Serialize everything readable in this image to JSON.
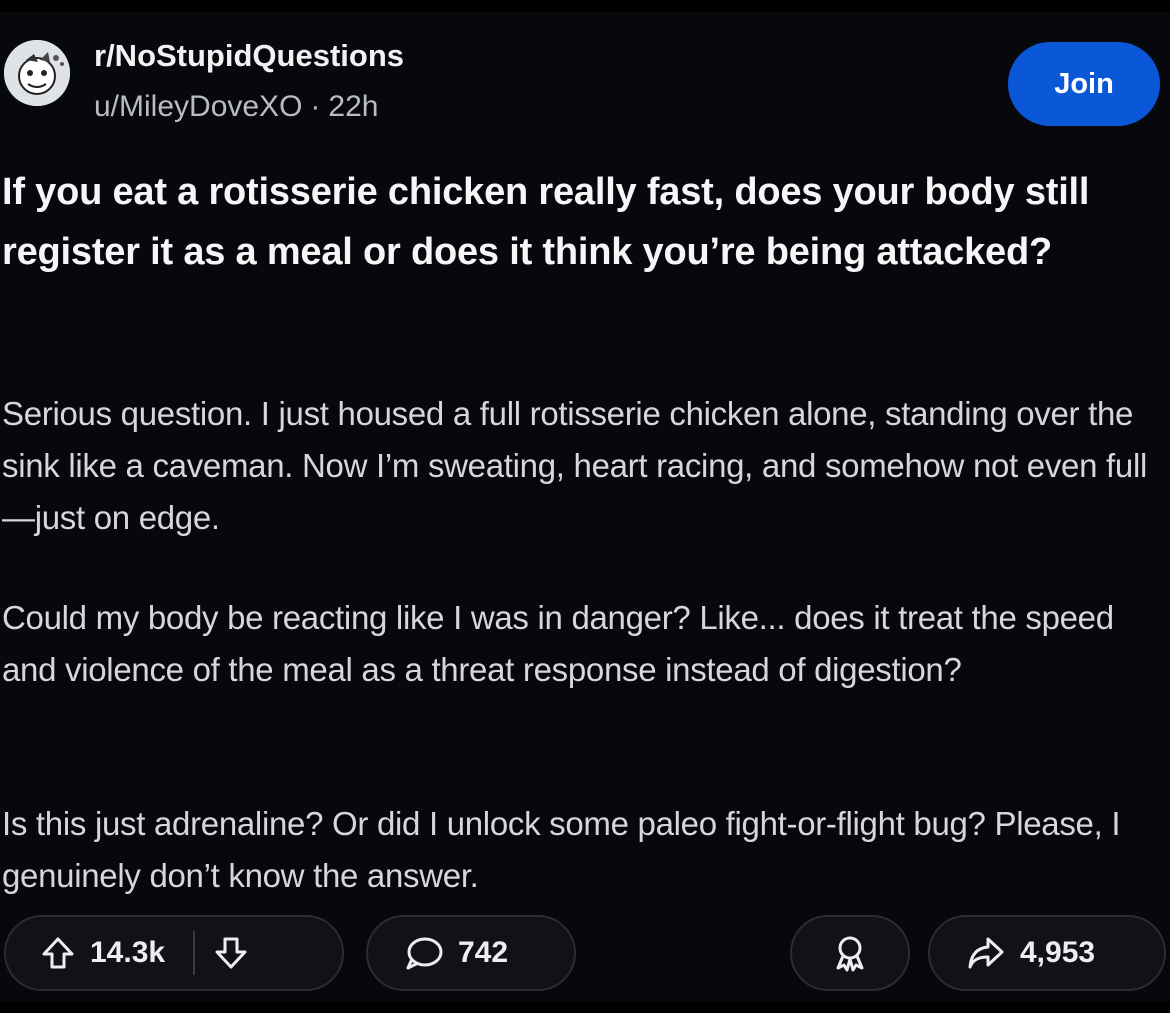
{
  "post": {
    "subreddit": "r/NoStupidQuestions",
    "author": "u/MileyDoveXO",
    "separator": "·",
    "age": "22h",
    "join_label": "Join",
    "title": "If you eat a rotisserie chicken really fast, does your body still register it as a meal or does it think you’re being attacked?",
    "body": [
      "Serious question. I just housed a full rotisserie chicken alone, standing over the sink like a caveman. Now I’m sweating, heart racing, and somehow not even full—just on edge.",
      "Could my body be reacting like I was in danger? Like... does it treat the speed and violence of the meal as a threat response instead of digestion?",
      "Is this just adrenaline? Or did I unlock some paleo fight-or-flight bug? Please, I genuinely don’t know the answer."
    ]
  },
  "actions": {
    "upvotes": "14.3k",
    "comments": "742",
    "shares": "4,953",
    "upvote_icon": "upvote-arrow-icon",
    "downvote_icon": "downvote-arrow-icon",
    "comment_icon": "speech-bubble-icon",
    "award_icon": "award-ribbon-icon",
    "share_icon": "share-arrow-icon"
  },
  "colors": {
    "background": "#07080b",
    "join_button": "#0a58d8",
    "text": "#e8e8ea"
  }
}
